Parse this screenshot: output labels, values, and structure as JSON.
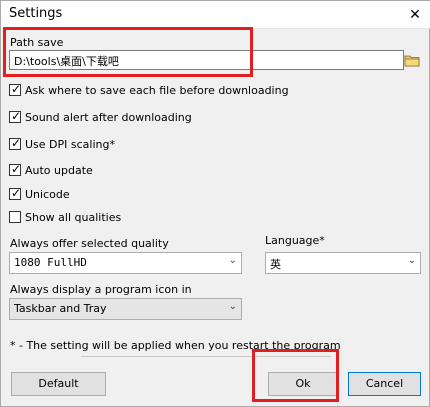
{
  "window": {
    "title": "Settings",
    "close_label": "✕"
  },
  "path": {
    "label": "Path save",
    "value": "D:\\tools\\桌面\\下载吧"
  },
  "checkboxes": [
    {
      "label": "Ask where to save each file before downloading",
      "checked": true
    },
    {
      "label": "Sound alert after downloading",
      "checked": true
    },
    {
      "label": "Use DPI scaling*",
      "checked": true
    },
    {
      "label": "Auto update",
      "checked": true
    },
    {
      "label": "Unicode",
      "checked": true
    },
    {
      "label": "Show all qualities",
      "checked": false
    }
  ],
  "quality": {
    "label": "Always offer selected quality",
    "value": "1080 FullHD"
  },
  "language": {
    "label": "Language*",
    "value": "英"
  },
  "icon": {
    "label": "Always display a program icon in",
    "value": "Taskbar and Tray"
  },
  "note": "* - The setting will be applied when you restart the program",
  "buttons": {
    "default": "Default",
    "ok": "Ok",
    "cancel": "Cancel"
  },
  "colors": {
    "highlight": "#e02020",
    "focus_border": "#0078d7"
  }
}
